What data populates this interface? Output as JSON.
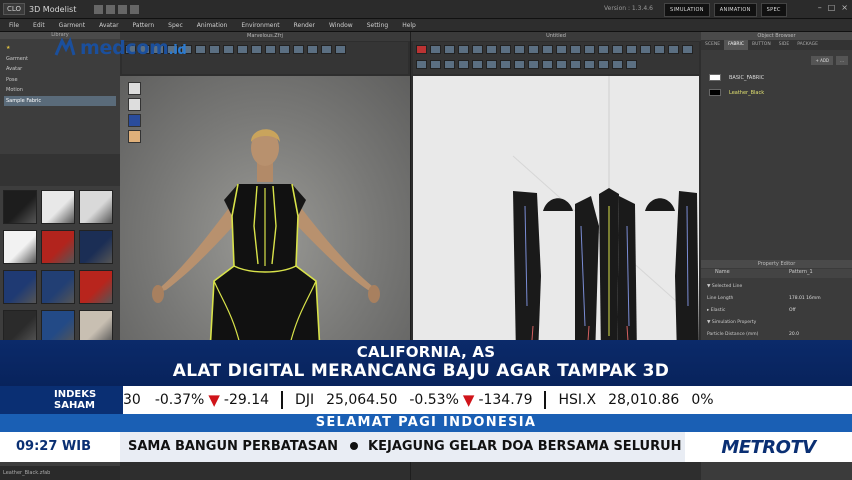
{
  "app": {
    "title": "3D Modelist",
    "version": "Version : 1.3.4.6",
    "modes": [
      "SIMULATION",
      "ANIMATION",
      "SPEC"
    ]
  },
  "menu": [
    "File",
    "Edit",
    "Garment",
    "Avatar",
    "Pattern",
    "Spec",
    "Animation",
    "Environment",
    "Render",
    "Window",
    "Setting",
    "Help"
  ],
  "library": {
    "header": "Library",
    "items": [
      {
        "label": "★",
        "kind": "star"
      },
      {
        "label": "Garment",
        "kind": "normal"
      },
      {
        "label": "Avatar",
        "kind": "normal"
      },
      {
        "label": "Pose",
        "kind": "normal"
      },
      {
        "label": "Motion",
        "kind": "normal"
      },
      {
        "label": "Sample Fabric",
        "kind": "selected"
      }
    ],
    "swatch_colors": [
      "#1d1d1d",
      "#e8e8e8",
      "#d9d9d9",
      "#f2f2f2",
      "#b2241d",
      "#1b2e55",
      "#1f3a73",
      "#223f74",
      "#b8251d",
      "#2b2b2b",
      "#234a86",
      "#c8bfb2"
    ]
  },
  "viewport3d": {
    "title": "Marvelous.Zfrj"
  },
  "viewport2d": {
    "title": "Untitled"
  },
  "object_browser": {
    "title": "Object Browser",
    "tabs": [
      "SCENE",
      "FABRIC",
      "BUTTON",
      "SIDE",
      "PACKAGE"
    ],
    "active_tab": "FABRIC",
    "add_label": "+ ADD",
    "fabrics": [
      {
        "name": "BASIC_FABRIC",
        "color": "#ffffff"
      },
      {
        "name": "Leather_Black",
        "color": "#000000"
      }
    ]
  },
  "property_editor": {
    "title": "Property Editor",
    "head_name": "Name",
    "head_value": "Pattern_1",
    "rows": [
      {
        "k": "▼ Selected Line",
        "v": ""
      },
      {
        "k": "Line Length",
        "v": "178.01 16mm"
      },
      {
        "k": "▸ Elastic",
        "v": "Off"
      },
      {
        "k": "▼ Simulation Property",
        "v": ""
      },
      {
        "k": "Particle Distance (mm)",
        "v": "20.0"
      }
    ]
  },
  "status": {
    "file": "Leather_Black.zfab"
  },
  "watermark": {
    "name": "medcom",
    "suffix": ".id"
  },
  "news": {
    "location": "CALIFORNIA, AS",
    "headline": "ALAT DIGITAL MERANCANG BAJU AGAR TAMPAK 3D",
    "index_label_1": "INDEKS",
    "index_label_2": "SAHAM",
    "ticker": {
      "lead_value": "30",
      "lead_pct": "-0.37%",
      "lead_change": "-29.14",
      "dji_name": "DJI",
      "dji_value": "25,064.50",
      "dji_pct": "-0.53%",
      "dji_change": "-134.79",
      "hsi_name": "HSI.X",
      "hsi_value": "28,010.86",
      "hsi_pct": "0%"
    },
    "program": "SELAMAT PAGI INDONESIA",
    "time": "09:27 WIB",
    "running_1": "SAMA BANGUN PERBATASAN",
    "running_2": "KEJAGUNG GELAR DOA BERSAMA SELURUH",
    "channel_1": "METRO",
    "channel_2": "TV"
  }
}
